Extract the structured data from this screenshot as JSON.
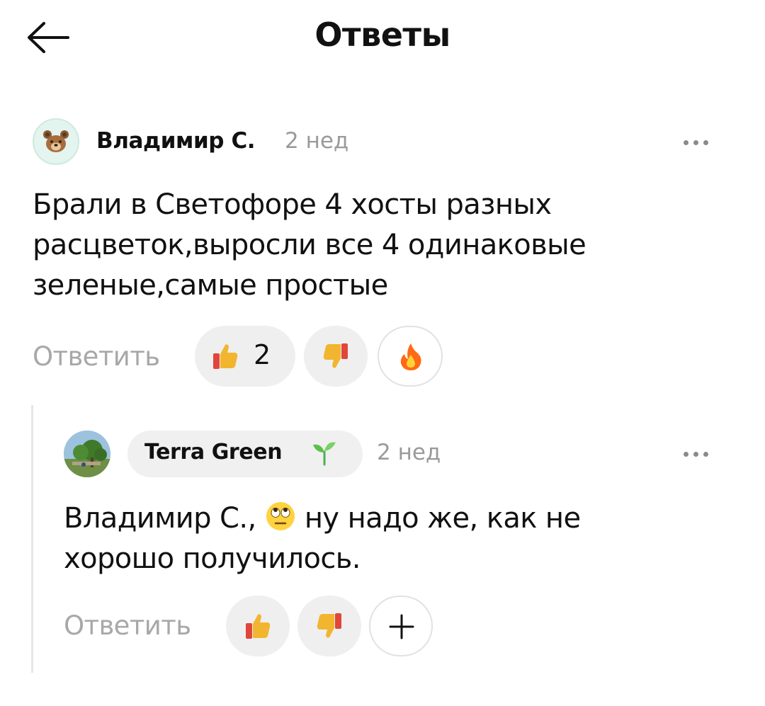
{
  "header": {
    "title": "Ответы",
    "back_icon": "arrow-left-icon"
  },
  "comment": {
    "author": "Владимир С.",
    "avatar_icon": "bear-face-icon",
    "time": "2 нед",
    "text_lines": [
      "Брали в Светофоре 4 хосты разных",
      "расцветок,выросли все 4 одинаковые",
      "зеленые,самые простые"
    ],
    "reply_label": "Ответить",
    "reactions": [
      {
        "icon": "thumbs-up-icon",
        "count": "2"
      },
      {
        "icon": "thumbs-down-icon",
        "count": ""
      },
      {
        "icon": "fire-icon",
        "count": ""
      }
    ]
  },
  "reply": {
    "author": "Terra Green",
    "author_badge": "seedling-icon",
    "avatar_icon": "garden-photo",
    "time": "2 нед",
    "text_line1_before": "Владимир С.,",
    "text_line1_emoji": "face-with-rolling-eyes-icon",
    "text_line1_after": "ну надо же, как не",
    "text_line2": "хорошо получилось.",
    "reply_label": "Ответить",
    "reactions": [
      {
        "icon": "thumbs-up-icon",
        "count": ""
      },
      {
        "icon": "thumbs-down-icon",
        "count": ""
      },
      {
        "icon": "plus-icon",
        "count": ""
      }
    ]
  },
  "colors": {
    "text": "#111111",
    "muted": "#9a9a9a",
    "reply_link": "#a8a8a8",
    "chip_bg": "#efefef",
    "thread_line": "#e6e6e6"
  }
}
